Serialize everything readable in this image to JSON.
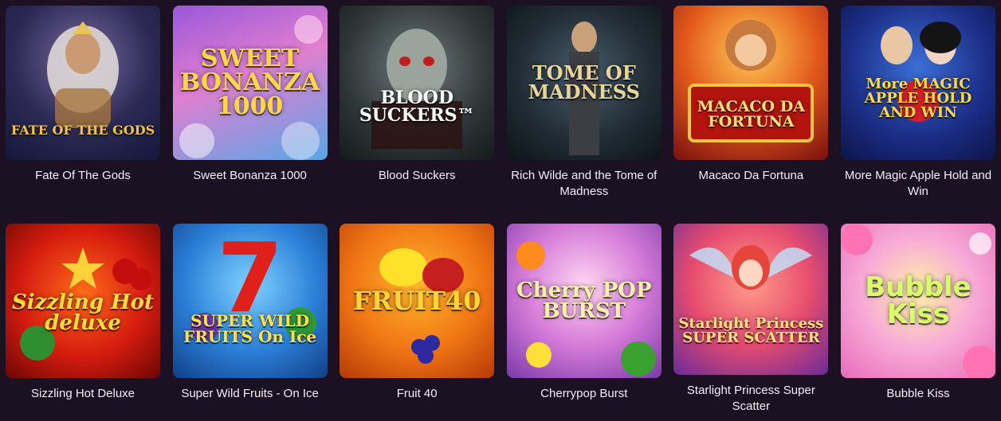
{
  "games": [
    {
      "title": "Fate Of The Gods",
      "art": "FATE OF THE GODS",
      "color": "#f2c14e"
    },
    {
      "title": "Sweet Bonanza 1000",
      "art": "SWEET BONANZA 1000",
      "color": "#ffd54a"
    },
    {
      "title": "Blood Suckers",
      "art": "BLOOD SUCKERS™",
      "color": "#ffffff"
    },
    {
      "title": "Rich Wilde and the Tome of Madness",
      "art": "TOME OF MADNESS",
      "color": "#e8d59a"
    },
    {
      "title": "Macaco Da Fortuna",
      "art": "MACACO DA FORTUNA",
      "color": "#ffe07a"
    },
    {
      "title": "More Magic Apple Hold and Win",
      "art": "More MAGIC APPLE HOLD AND WIN",
      "color": "#ffd94a"
    },
    {
      "title": "Sizzling Hot Deluxe",
      "art": "Sizzling Hot deluxe",
      "color": "#ffdc3a"
    },
    {
      "title": "Super Wild Fruits - On Ice",
      "art": "SUPER WILD FRUITS On Ice",
      "color": "#ffe14d"
    },
    {
      "title": "Fruit 40",
      "art": "FRUIT40",
      "color": "#ffd43a"
    },
    {
      "title": "Cherrypop Burst",
      "art": "Cherry POP BURST",
      "color": "#fff2a8"
    },
    {
      "title": "Starlight Princess Super Scatter",
      "art": "Starlight Princess SUPER SCATTER",
      "color": "#ffe27a"
    },
    {
      "title": "Bubble Kiss",
      "art": "Bubble Kiss",
      "color": "#d7ff6a"
    }
  ]
}
